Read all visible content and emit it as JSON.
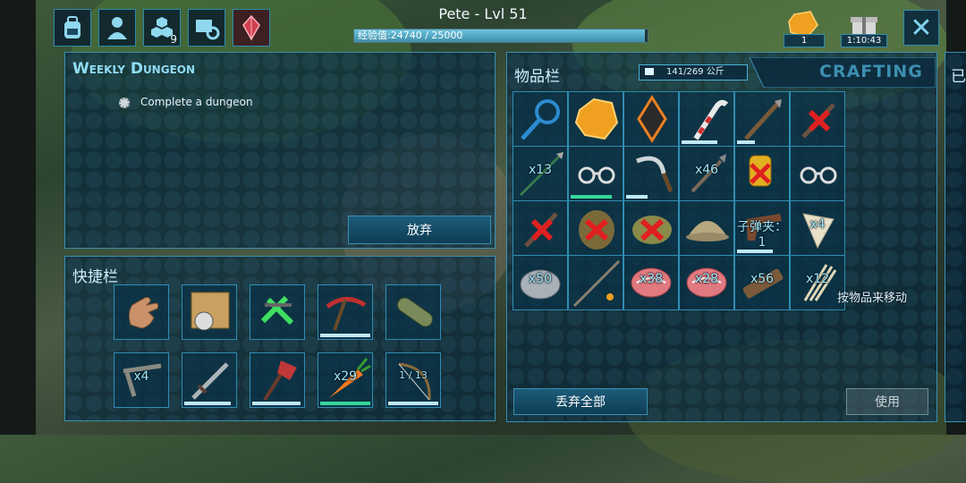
{
  "hud": {
    "player_name": "Pete - Lvl 51",
    "xp_text": "经验值:24740 / 25000",
    "xp_progress": 0.99,
    "engram_badge": "9",
    "gem_count": "1",
    "gift_timer": "1:10:43"
  },
  "weekly": {
    "title": "Weekly Dungeon",
    "task": "Complete a dungeon",
    "abandon_label": "放弃"
  },
  "hotbar": {
    "title": "快捷栏",
    "slots": [
      {
        "icon": "hand-icon",
        "qty": ""
      },
      {
        "icon": "map-compass-icon",
        "qty": ""
      },
      {
        "icon": "blueprint-green-icon",
        "qty": ""
      },
      {
        "icon": "pickaxe-icon",
        "qty": ""
      },
      {
        "icon": "log-roll-icon",
        "qty": ""
      },
      {
        "icon": "wooden-club-icon",
        "qty": "x4"
      },
      {
        "icon": "sword-icon",
        "qty": ""
      },
      {
        "icon": "hatchet-icon",
        "qty": ""
      },
      {
        "icon": "carrot-icon",
        "qty": "x29"
      },
      {
        "icon": "bow-icon",
        "qty": "1 / 13"
      }
    ]
  },
  "inventory": {
    "title": "物品栏",
    "weight": "141/269 公斤",
    "crafting_tab": "CRAFTING",
    "hint": "按物品来移动",
    "drop_all_label": "丢弃全部",
    "use_label": "使用",
    "slots": [
      {
        "icon": "magnifier-icon",
        "qty": ""
      },
      {
        "icon": "amber-icon",
        "qty": ""
      },
      {
        "icon": "dark-crystal-icon",
        "qty": ""
      },
      {
        "icon": "candy-cane-icon",
        "qty": ""
      },
      {
        "icon": "spear-icon",
        "qty": ""
      },
      {
        "icon": "broken-item-icon",
        "qty": ""
      },
      {
        "icon": "arrow-icon",
        "qty": "x13"
      },
      {
        "icon": "glasses-icon",
        "qty": ""
      },
      {
        "icon": "sickle-icon",
        "qty": ""
      },
      {
        "icon": "spear-tip-icon",
        "qty": "x46"
      },
      {
        "icon": "gloves-icon",
        "qty": ""
      },
      {
        "icon": "glasses-icon",
        "qty": ""
      },
      {
        "icon": "broken-item-icon",
        "qty": ""
      },
      {
        "icon": "leather-broken-icon",
        "qty": ""
      },
      {
        "icon": "armor-broken-icon",
        "qty": ""
      },
      {
        "icon": "pith-helmet-icon",
        "qty": ""
      },
      {
        "icon": "pistol-icon",
        "qty": "子弹夹：1"
      },
      {
        "icon": "tooth-icon",
        "qty": "x4"
      },
      {
        "icon": "stone-icon",
        "qty": "x50"
      },
      {
        "icon": "long-spear-icon",
        "qty": ""
      },
      {
        "icon": "raw-meat-icon",
        "qty": "x38"
      },
      {
        "icon": "raw-meat-icon",
        "qty": "x28"
      },
      {
        "icon": "wood-icon",
        "qty": "x56"
      },
      {
        "icon": "fiber-icon",
        "qty": "x12"
      }
    ]
  },
  "right_panel": {
    "title_fragment": "已"
  },
  "colors": {
    "accent": "#3b8fb2",
    "qty_text": "#9fe9ff",
    "title": "#8fdcf5"
  }
}
